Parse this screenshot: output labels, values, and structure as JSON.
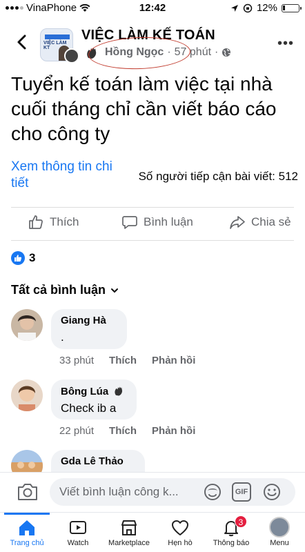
{
  "status_bar": {
    "carrier": "VinaPhone",
    "time": "12:42",
    "battery": "12%"
  },
  "header": {
    "group_name": "VIỆC LÀM KẾ TOÁN",
    "group_logo_text": "VIỆC LÀM KT",
    "author": "Hồng Ngọc",
    "separator": "·",
    "time_ago": "57 phút",
    "annotation_color": "#c0392b"
  },
  "post": {
    "text": "Tuyển kế toán làm việc tại nhà cuối tháng chỉ cần viết báo cáo cho công ty",
    "see_more": "Xem thông tin chi tiết",
    "reach": "Số người tiếp cận bài viết: 512"
  },
  "actions": {
    "like": "Thích",
    "comment": "Bình luận",
    "share": "Chia sẻ"
  },
  "reactions": {
    "count": "3"
  },
  "comments_filter": "Tất cả bình luận",
  "comments": [
    {
      "name": "Giang Hà",
      "text": ".",
      "time": "33 phút",
      "like": "Thích",
      "reply": "Phản hồi"
    },
    {
      "name": "Bông Lúa",
      "text": "Check ib a",
      "time": "22 phút",
      "like": "Thích",
      "reply": "Phản hồi"
    },
    {
      "name": "Gda Lê Thảo"
    }
  ],
  "composer": {
    "placeholder": "Viết bình luận công k...",
    "gif_label": "GIF"
  },
  "tabs": [
    {
      "label": "Trang chủ",
      "active": true
    },
    {
      "label": "Watch"
    },
    {
      "label": "Marketplace"
    },
    {
      "label": "Hẹn hò"
    },
    {
      "label": "Thông báo",
      "badge": "3"
    },
    {
      "label": "Menu"
    }
  ],
  "colors": {
    "accent": "#1877f2",
    "badge": "#e41e3f",
    "muted": "#65676b"
  }
}
